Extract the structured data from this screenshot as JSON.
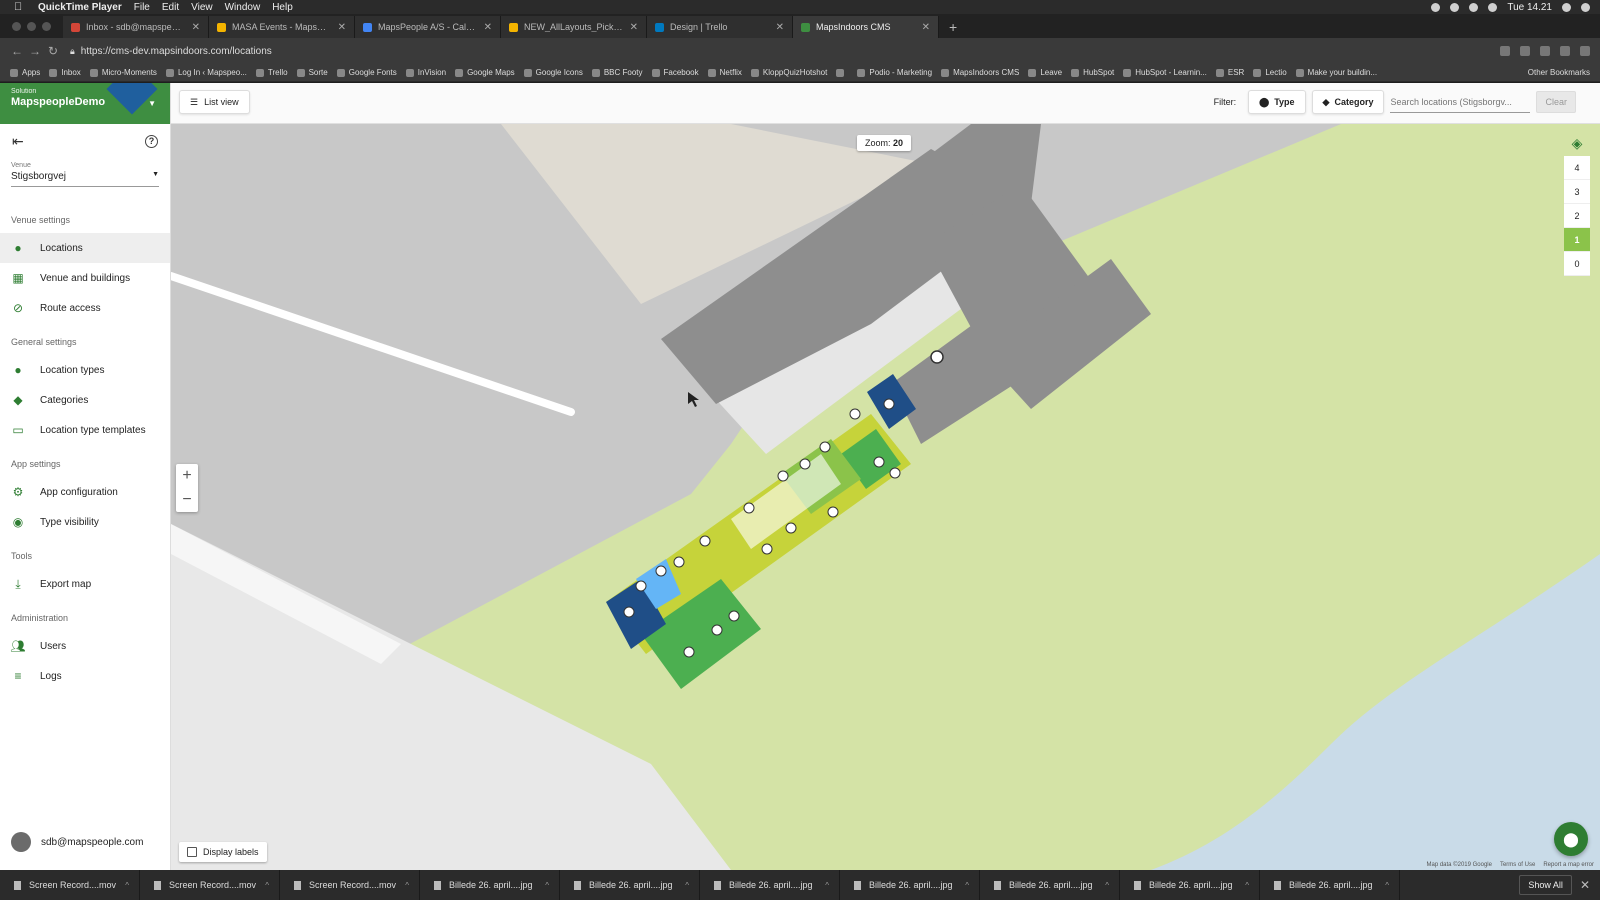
{
  "menubar": {
    "app": "QuickTime Player",
    "items": [
      "File",
      "Edit",
      "View",
      "Window",
      "Help"
    ],
    "clock": "Tue 14.21"
  },
  "tabs": [
    {
      "title": "Inbox - sdb@mapspeople.com",
      "color": "#d44638"
    },
    {
      "title": "MASA Events - MapsPeople E...",
      "color": "#f4b400"
    },
    {
      "title": "MapsPeople A/S - Calendar - W...",
      "color": "#4285f4"
    },
    {
      "title": "NEW_AllLayouts_PickWhatYou...",
      "color": "#f4b400"
    },
    {
      "title": "Design | Trello",
      "color": "#0079bf"
    },
    {
      "title": "MapsIndoors CMS",
      "color": "#3e8e41"
    }
  ],
  "address": {
    "url": "https://cms-dev.mapsindoors.com/locations"
  },
  "bookmarks": [
    "Apps",
    "Inbox",
    "Micro-Moments",
    "Log In ‹ Mapspeo...",
    "Trello",
    "Sorte",
    "Google Fonts",
    "InVision",
    "Google Maps",
    "Google Icons",
    "BBC Footy",
    "Facebook",
    "Netflix",
    "KloppQuizHotshot",
    "",
    "Podio - Marketing",
    "MapsIndoors CMS",
    "Leave",
    "HubSpot",
    "HubSpot - Learnin...",
    "ESR",
    "Lectio",
    "Make your buildin..."
  ],
  "bookmarks_other": "Other Bookmarks",
  "sidebar": {
    "solution_label": "Solution",
    "solution_name": "MapspeopleDemo",
    "venue_label": "Venue",
    "venue_value": "Stigsborgvej",
    "sections": [
      {
        "title": "Venue settings",
        "items": [
          {
            "label": "Locations",
            "icon": "pin"
          },
          {
            "label": "Venue and buildings",
            "icon": "building"
          },
          {
            "label": "Route access",
            "icon": "block"
          }
        ]
      },
      {
        "title": "General settings",
        "items": [
          {
            "label": "Location types",
            "icon": "pin"
          },
          {
            "label": "Categories",
            "icon": "tag"
          },
          {
            "label": "Location type templates",
            "icon": "template"
          }
        ]
      },
      {
        "title": "App settings",
        "items": [
          {
            "label": "App configuration",
            "icon": "config"
          },
          {
            "label": "Type visibility",
            "icon": "eye"
          }
        ]
      },
      {
        "title": "Tools",
        "items": [
          {
            "label": "Export map",
            "icon": "download"
          }
        ]
      },
      {
        "title": "Administration",
        "items": [
          {
            "label": "Users",
            "icon": "users"
          },
          {
            "label": "Logs",
            "icon": "list"
          }
        ]
      }
    ],
    "user": "sdb@mapspeople.com"
  },
  "toolbar": {
    "list_view": "List view",
    "filter_label": "Filter:",
    "type": "Type",
    "category": "Category",
    "search_placeholder": "Search locations (Stigsborgv...",
    "clear": "Clear"
  },
  "map": {
    "zoom_label": "Zoom:",
    "zoom_value": "20",
    "floors": [
      "4",
      "3",
      "2",
      "1",
      "0"
    ],
    "active_floor": "1",
    "display_labels": "Display labels",
    "attribution": [
      "Map data ©2019 Google",
      "Terms of Use",
      "Report a map error"
    ]
  },
  "downloads": [
    "Screen Record....mov",
    "Screen Record....mov",
    "Screen Record....mov",
    "Billede 26. april....jpg",
    "Billede 26. april....jpg",
    "Billede 26. april....jpg",
    "Billede 26. april....jpg",
    "Billede 26. april....jpg",
    "Billede 26. april....jpg",
    "Billede 26. april....jpg"
  ],
  "show_all": "Show All",
  "colors": {
    "accent": "#3e8e41",
    "floor_active": "#8bc34a",
    "lime": "#c6d33a",
    "dark_blue": "#1f4e87"
  }
}
